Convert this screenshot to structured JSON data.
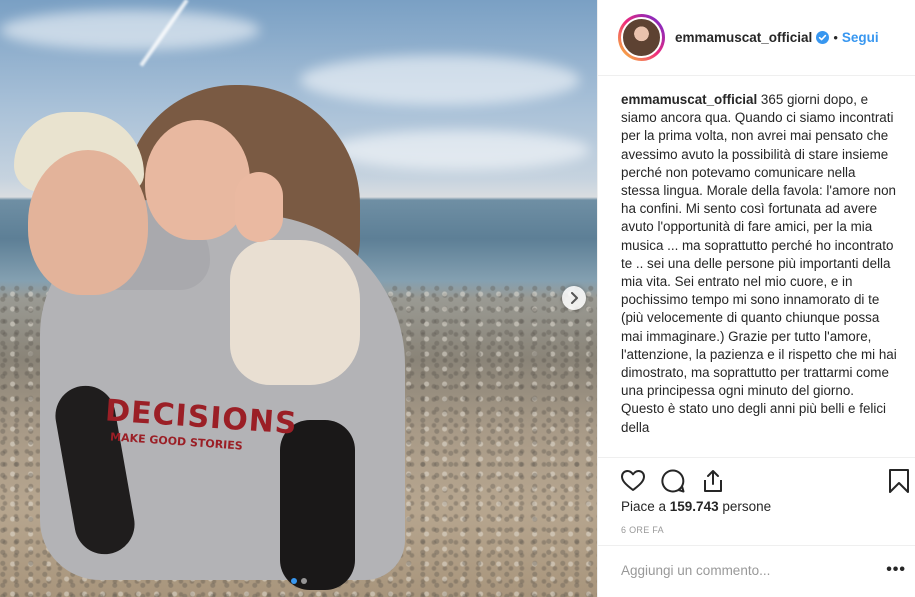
{
  "post": {
    "username": "emmamuscat_official",
    "follow_label": "Segui",
    "separator": "•",
    "verified_icon": "verified-badge-icon",
    "caption_user": "emmamuscat_official",
    "caption_text": " 365 giorni dopo, e siamo ancora qua. Quando ci siamo incontrati per la prima volta, non avrei mai pensato che avessimo avuto la possibilità di stare insieme perché non potevamo comunicare nella stessa lingua. Morale della favola: l'amore non ha confini. Mi sento così fortunata ad avere avuto l'opportunità di fare amici, per la mia musica ... ma soprattutto perché ho incontrato te .. sei una delle persone più importanti della mia vita. Sei entrato nel mio cuore, e in pochissimo tempo mi sono innamorato di te (più velocemente di quanto chiunque possa mai immaginare.) Grazie per tutto l'amore, l'attenzione, la pazienza e il rispetto che mi hai dimostrato, ma soprattutto per trattarmi come una principessa ogni minuto del giorno. Questo è stato uno degli anni più belli e felici della",
    "likes_prefix": "Piace a ",
    "likes_count": "159.743",
    "likes_suffix": " persone",
    "timestamp": "6 ORE FA",
    "comment_placeholder": "Aggiungi un commento...",
    "more_label": "•••",
    "carousel": {
      "total": 2,
      "active": 1
    },
    "hoodie_print": {
      "main": "DECISIONS",
      "sub": "MAKE GOOD STORIES"
    }
  },
  "icons": {
    "like": "heart-icon",
    "comment": "comment-icon",
    "share": "share-icon",
    "save": "bookmark-icon",
    "next": "chevron-right-icon"
  },
  "colors": {
    "accent": "#3897f0",
    "text": "#262626",
    "muted": "#999999",
    "border": "#efefef"
  }
}
